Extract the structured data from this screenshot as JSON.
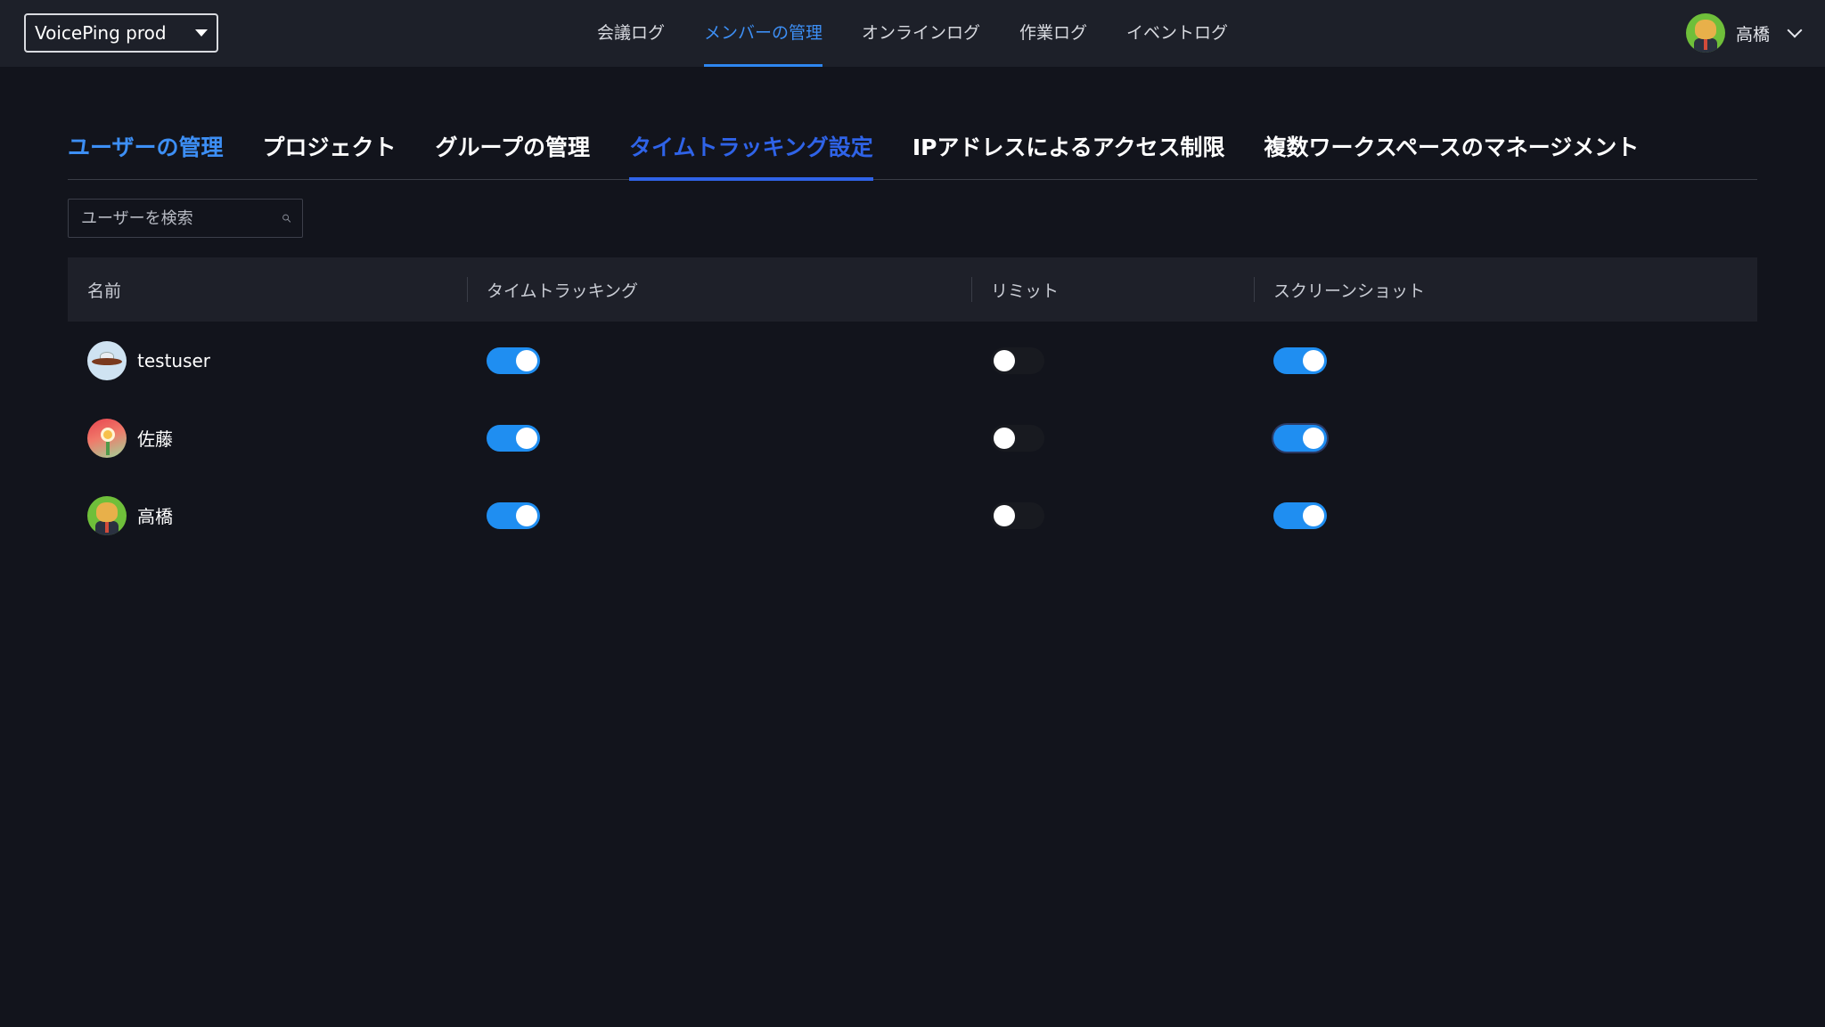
{
  "topbar": {
    "workspace": "VoicePing prod",
    "nav": [
      "会議ログ",
      "メンバーの管理",
      "オンラインログ",
      "作業ログ",
      "イベントログ"
    ],
    "active_nav": 1,
    "user_name": "高橋"
  },
  "subtabs": {
    "items": [
      "ユーザーの管理",
      "プロジェクト",
      "グループの管理",
      "タイムトラッキング設定",
      "IPアドレスによるアクセス制限",
      "複数ワークスペースのマネージメント"
    ],
    "active": 3
  },
  "search": {
    "placeholder": "ユーザーを検索",
    "value": ""
  },
  "table": {
    "headers": [
      "名前",
      "タイムトラッキング",
      "リミット",
      "スクリーンショット"
    ],
    "rows": [
      {
        "name": "testuser",
        "avatar": "ufo-avatar",
        "time_tracking": true,
        "limit": false,
        "screenshot": true
      },
      {
        "name": "佐藤",
        "avatar": "flower-avatar",
        "time_tracking": true,
        "limit": false,
        "screenshot": true
      },
      {
        "name": "高橋",
        "avatar": "shiba-avatar",
        "time_tracking": true,
        "limit": false,
        "screenshot": true
      }
    ]
  },
  "colors": {
    "background": "#12141c",
    "topbar": "#1d2029",
    "accent": "#3d8ff5",
    "active_tab": "#2f63e8",
    "toggle_on": "#1f8ef1"
  }
}
